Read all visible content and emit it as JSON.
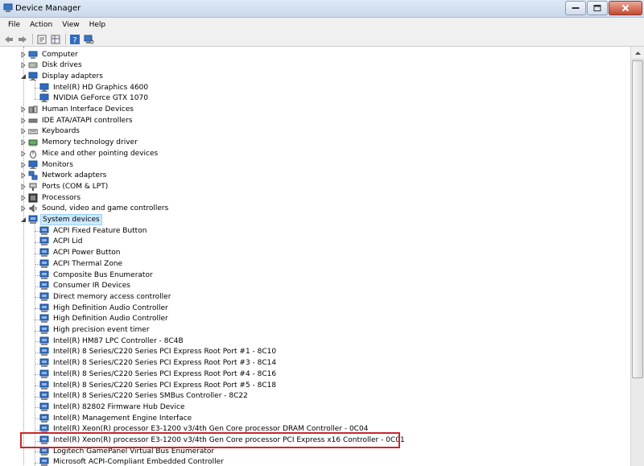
{
  "window": {
    "title": "Device Manager"
  },
  "menu": [
    "File",
    "Action",
    "View",
    "Help"
  ],
  "toolbar": [
    "back-icon",
    "forward-icon",
    "properties-icon",
    "grid-icon",
    "help-icon",
    "scan-icon"
  ],
  "tree": [
    {
      "label": "Computer",
      "level": 1,
      "expander": "collapsed",
      "icon": "computer-icon"
    },
    {
      "label": "Disk drives",
      "level": 1,
      "expander": "collapsed",
      "icon": "disk-icon"
    },
    {
      "label": "Display adapters",
      "level": 1,
      "expander": "expanded",
      "icon": "monitor-icon"
    },
    {
      "label": "Intel(R) HD Graphics 4600",
      "level": 2,
      "expander": "none",
      "icon": "monitor-icon"
    },
    {
      "label": "NVIDIA GeForce GTX 1070",
      "level": 2,
      "expander": "none",
      "icon": "monitor-icon"
    },
    {
      "label": "Human Interface Devices",
      "level": 1,
      "expander": "collapsed",
      "icon": "hid-icon"
    },
    {
      "label": "IDE ATA/ATAPI controllers",
      "level": 1,
      "expander": "collapsed",
      "icon": "ide-icon"
    },
    {
      "label": "Keyboards",
      "level": 1,
      "expander": "collapsed",
      "icon": "keyboard-icon"
    },
    {
      "label": "Memory technology driver",
      "level": 1,
      "expander": "collapsed",
      "icon": "memory-icon"
    },
    {
      "label": "Mice and other pointing devices",
      "level": 1,
      "expander": "collapsed",
      "icon": "mouse-icon"
    },
    {
      "label": "Monitors",
      "level": 1,
      "expander": "collapsed",
      "icon": "monitor-icon"
    },
    {
      "label": "Network adapters",
      "level": 1,
      "expander": "collapsed",
      "icon": "network-icon"
    },
    {
      "label": "Ports (COM & LPT)",
      "level": 1,
      "expander": "collapsed",
      "icon": "port-icon"
    },
    {
      "label": "Processors",
      "level": 1,
      "expander": "collapsed",
      "icon": "processor-icon"
    },
    {
      "label": "Sound, video and game controllers",
      "level": 1,
      "expander": "collapsed",
      "icon": "sound-icon"
    },
    {
      "label": "System devices",
      "level": 1,
      "expander": "expanded",
      "icon": "system-icon",
      "selected": true
    },
    {
      "label": "ACPI Fixed Feature Button",
      "level": 2,
      "expander": "none",
      "icon": "system-icon"
    },
    {
      "label": "ACPI Lid",
      "level": 2,
      "expander": "none",
      "icon": "system-icon"
    },
    {
      "label": "ACPI Power Button",
      "level": 2,
      "expander": "none",
      "icon": "system-icon"
    },
    {
      "label": "ACPI Thermal Zone",
      "level": 2,
      "expander": "none",
      "icon": "system-icon"
    },
    {
      "label": "Composite Bus Enumerator",
      "level": 2,
      "expander": "none",
      "icon": "system-icon"
    },
    {
      "label": "Consumer IR Devices",
      "level": 2,
      "expander": "none",
      "icon": "system-icon"
    },
    {
      "label": "Direct memory access controller",
      "level": 2,
      "expander": "none",
      "icon": "system-icon"
    },
    {
      "label": "High Definition Audio Controller",
      "level": 2,
      "expander": "none",
      "icon": "system-icon"
    },
    {
      "label": "High Definition Audio Controller",
      "level": 2,
      "expander": "none",
      "icon": "system-icon"
    },
    {
      "label": "High precision event timer",
      "level": 2,
      "expander": "none",
      "icon": "system-icon"
    },
    {
      "label": "Intel(R)  HM87 LPC Controller - 8C4B",
      "level": 2,
      "expander": "none",
      "icon": "system-icon"
    },
    {
      "label": "Intel(R) 8 Series/C220 Series  PCI Express Root Port #1 - 8C10",
      "level": 2,
      "expander": "none",
      "icon": "system-icon"
    },
    {
      "label": "Intel(R) 8 Series/C220 Series  PCI Express Root Port #3 - 8C14",
      "level": 2,
      "expander": "none",
      "icon": "system-icon"
    },
    {
      "label": "Intel(R) 8 Series/C220 Series  PCI Express Root Port #4 - 8C16",
      "level": 2,
      "expander": "none",
      "icon": "system-icon"
    },
    {
      "label": "Intel(R) 8 Series/C220 Series  PCI Express Root Port #5 - 8C18",
      "level": 2,
      "expander": "none",
      "icon": "system-icon"
    },
    {
      "label": "Intel(R) 8 Series/C220 Series  SMBus Controller - 8C22",
      "level": 2,
      "expander": "none",
      "icon": "system-icon"
    },
    {
      "label": "Intel(R) 82802 Firmware Hub Device",
      "level": 2,
      "expander": "none",
      "icon": "system-icon"
    },
    {
      "label": "Intel(R) Management Engine Interface",
      "level": 2,
      "expander": "none",
      "icon": "system-icon"
    },
    {
      "label": "Intel(R) Xeon(R) processor E3-1200 v3/4th Gen Core processor DRAM Controller - 0C04",
      "level": 2,
      "expander": "none",
      "icon": "system-icon"
    },
    {
      "label": "Intel(R) Xeon(R) processor E3-1200 v3/4th Gen Core processor PCI Express x16 Controller - 0C01",
      "level": 2,
      "expander": "none",
      "icon": "system-icon",
      "highlighted": true
    },
    {
      "label": "Logitech GamePanel Virtual Bus Enumerator",
      "level": 2,
      "expander": "none",
      "icon": "system-icon"
    },
    {
      "label": "Microsoft ACPI-Compliant Embedded Controller",
      "level": 2,
      "expander": "none",
      "icon": "system-icon"
    }
  ],
  "colors": {
    "highlight_border": "#c8282e",
    "selection": "#cce8ff"
  }
}
